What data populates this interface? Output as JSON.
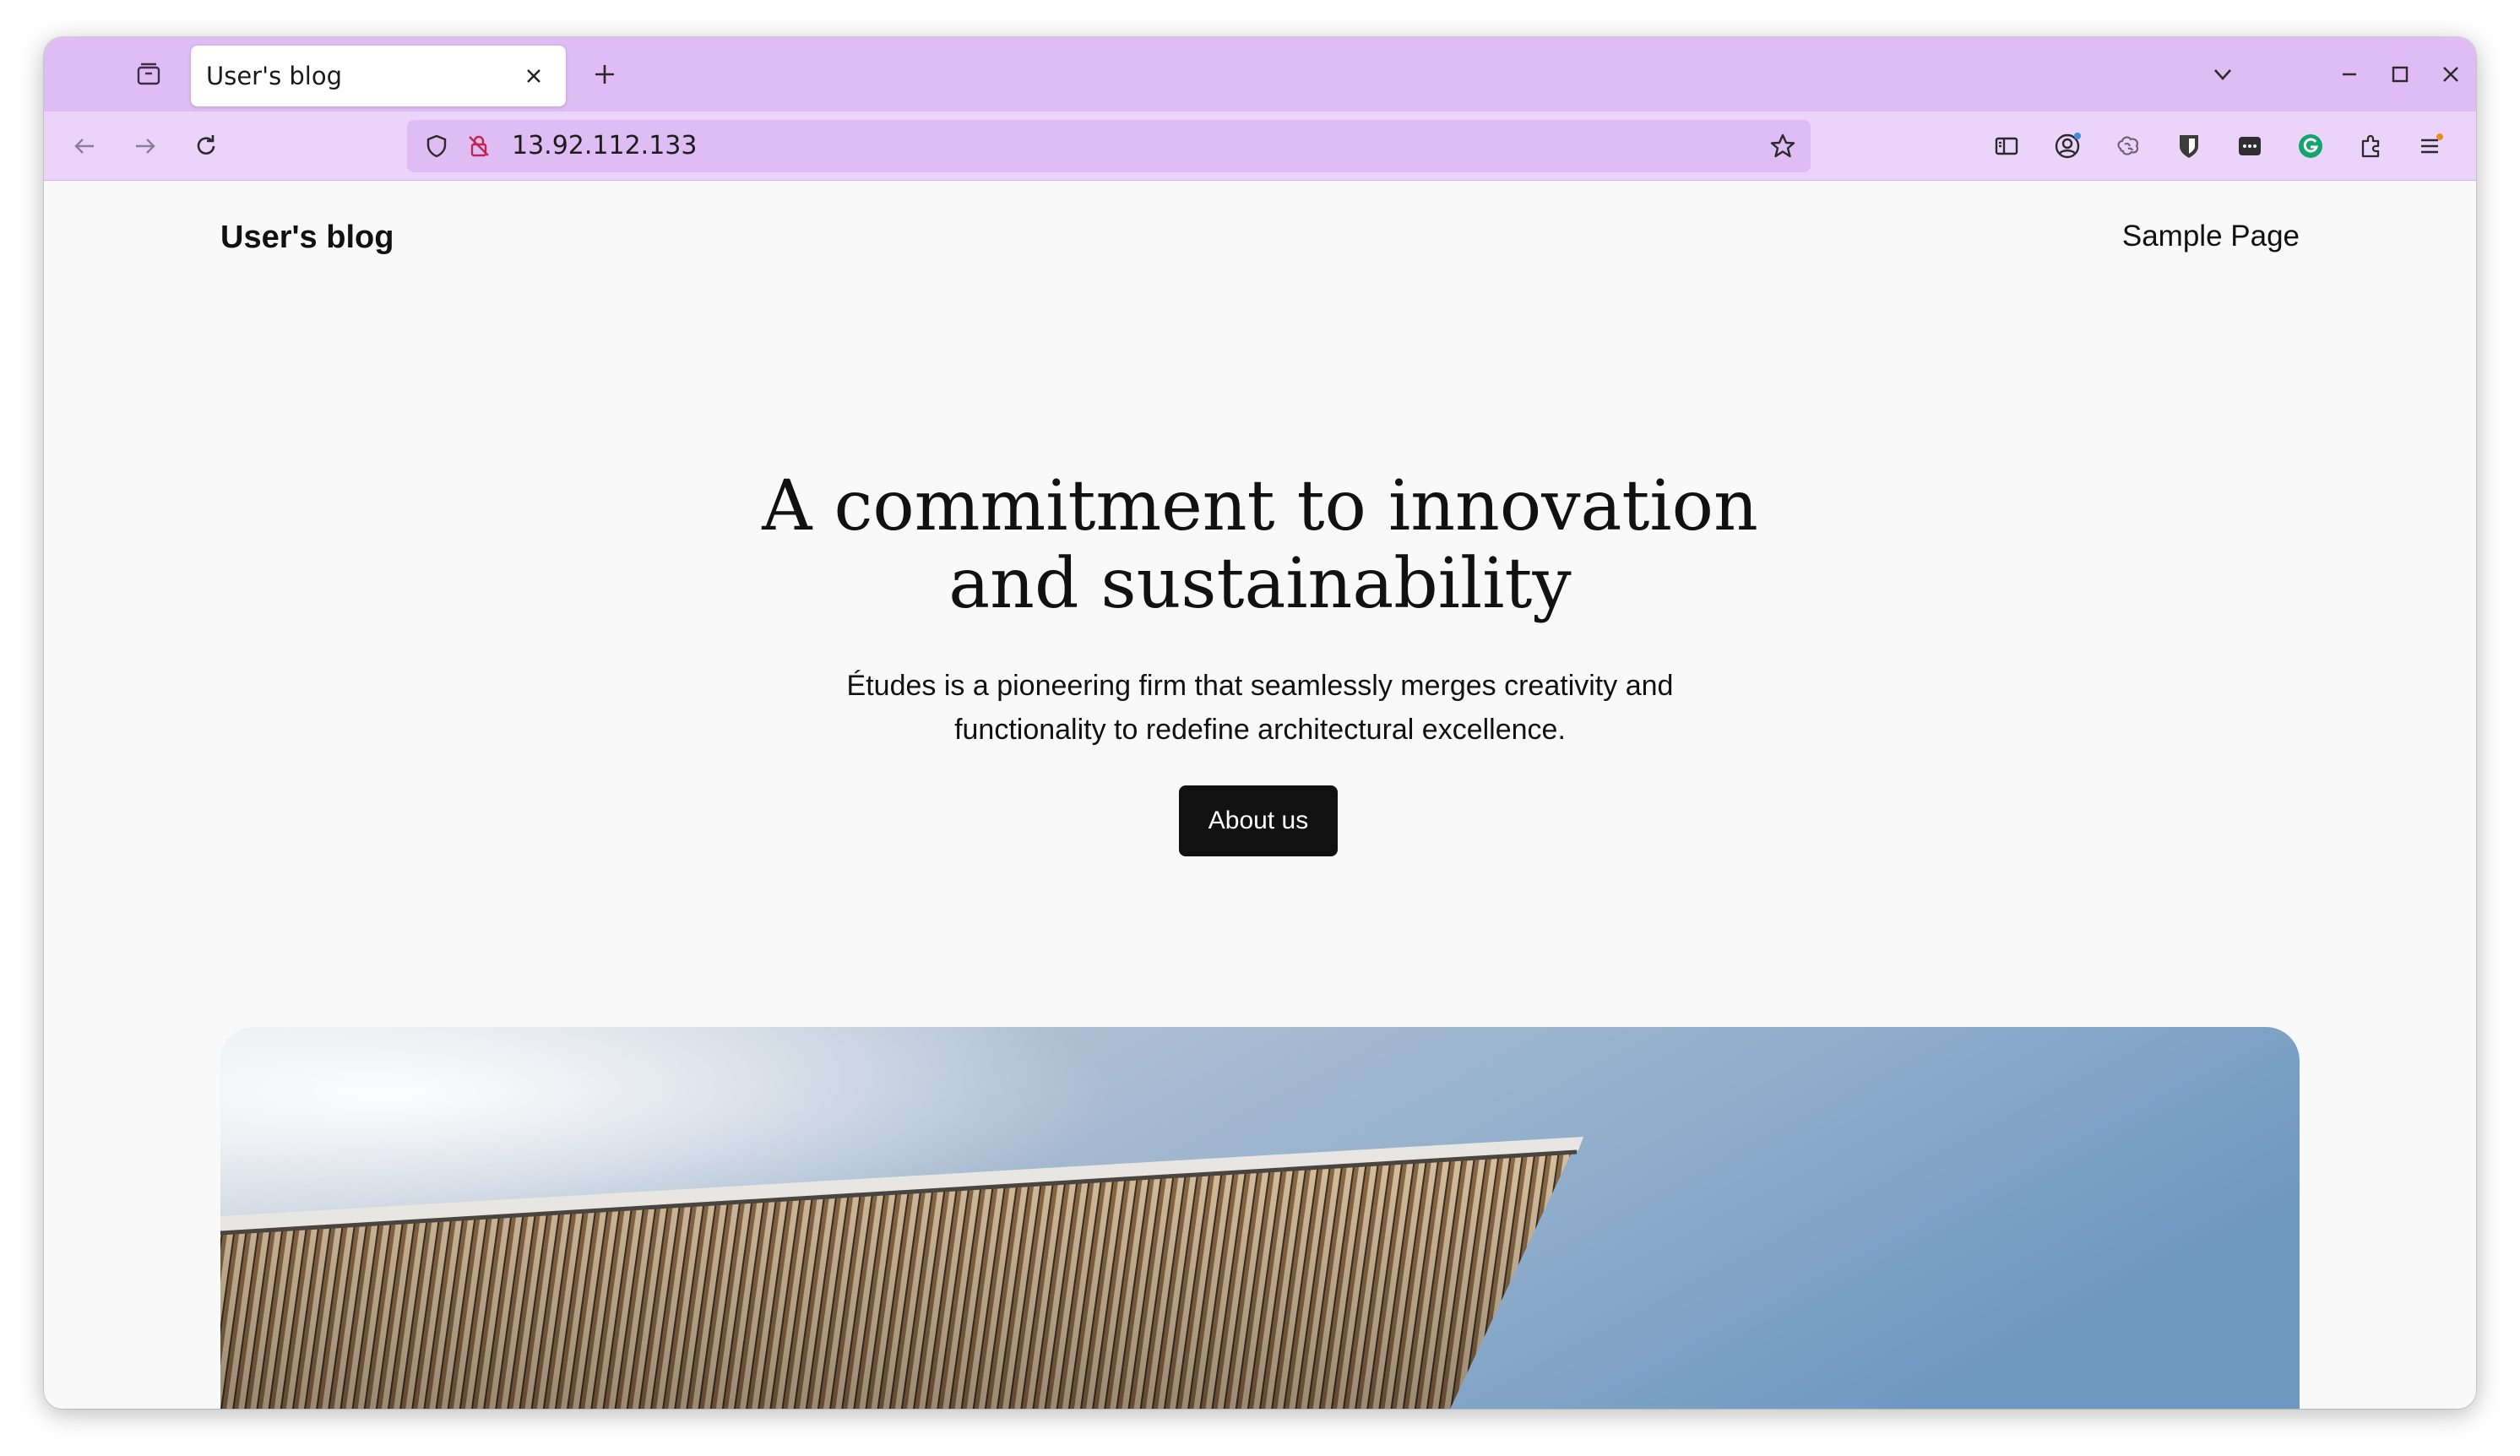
{
  "browser": {
    "tab": {
      "title": "User's blog"
    },
    "address": {
      "url": "13.92.112.133"
    }
  },
  "site": {
    "title": "User's blog",
    "nav": [
      {
        "label": "Sample Page"
      }
    ]
  },
  "hero": {
    "heading_line1": "A commitment to innovation",
    "heading_line2": "and sustainability",
    "description_line1": "Études is a pioneering firm that seamlessly merges creativity and",
    "description_line2": "functionality to redefine architectural excellence.",
    "button_label": "About us"
  },
  "colors": {
    "tabstrip": "#e0bcf5",
    "navbar": "#ecd3fa",
    "page_background": "#f9f9f9",
    "button": "#111111",
    "sky": "#7ea1c7"
  },
  "icons": {
    "tab_strip": [
      "tab-overview-icon",
      "close-icon",
      "new-tab-plus-icon",
      "list-all-tabs-chevron-icon",
      "minimize-icon",
      "maximize-icon",
      "window-close-icon"
    ],
    "nav_bar": [
      "back-arrow-icon",
      "forward-arrow-icon",
      "reload-icon",
      "shield-icon",
      "insecure-lock-icon",
      "bookmark-star-icon",
      "sidebar-icon",
      "account-icon",
      "extension-brain-icon",
      "bitwarden-icon",
      "password-icon",
      "grammarly-icon",
      "extensions-puzzle-icon",
      "hamburger-menu-icon"
    ]
  }
}
